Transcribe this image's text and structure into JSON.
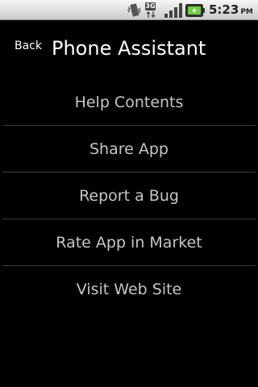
{
  "status_bar": {
    "icons": [
      "vibrate-icon",
      "3g-data-icon",
      "signal-strength-icon",
      "battery-charging-icon"
    ],
    "network_label": "3G",
    "time": "5:23",
    "ampm": "PM"
  },
  "header": {
    "back_label": "Back",
    "title": "Phone Assistant"
  },
  "menu": {
    "items": [
      {
        "label": "Help Contents"
      },
      {
        "label": "Share App"
      },
      {
        "label": "Report a Bug"
      },
      {
        "label": "Rate App in Market"
      },
      {
        "label": "Visit Web Site"
      }
    ]
  },
  "colors": {
    "background": "#000000",
    "status_bar": "#dcdcdc",
    "title_text": "#ffffff",
    "item_text": "#c6c6c6",
    "divider": "#3a3a3a",
    "battery_accent": "#6bd13a"
  }
}
